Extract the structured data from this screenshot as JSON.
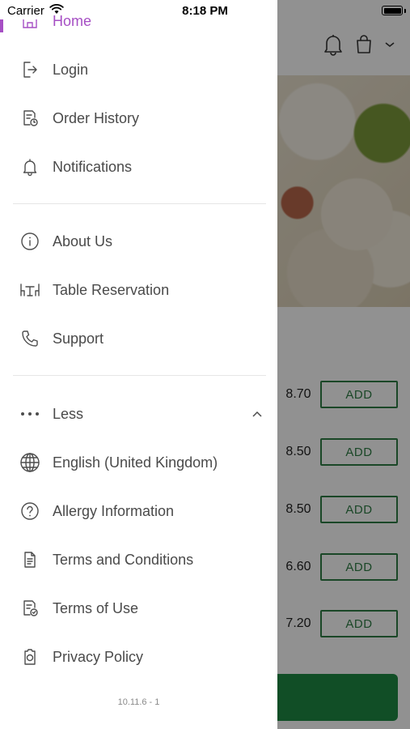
{
  "status_bar": {
    "carrier": "Carrier",
    "time": "8:18 PM"
  },
  "menu": {
    "home": "Home",
    "login": "Login",
    "order_history": "Order History",
    "notifications": "Notifications",
    "about_us": "About Us",
    "table_reservation": "Table Reservation",
    "support": "Support",
    "less": "Less",
    "language": "English (United Kingdom)",
    "allergy_information": "Allergy Information",
    "terms_and_conditions": "Terms and Conditions",
    "terms_of_use": "Terms of Use",
    "privacy_policy": "Privacy Policy"
  },
  "version": "10.11.6 - 1",
  "background_items": [
    {
      "price": "8.70",
      "add_label": "ADD"
    },
    {
      "price": "8.50",
      "add_label": "ADD"
    },
    {
      "price": "8.50",
      "add_label": "ADD"
    },
    {
      "price": "6.60",
      "add_label": "ADD"
    },
    {
      "price": "7.20",
      "add_label": "ADD"
    }
  ],
  "colors": {
    "accent": "#a64fc4",
    "brand_green": "#2e7d45",
    "cta_green": "#1f8a44"
  }
}
